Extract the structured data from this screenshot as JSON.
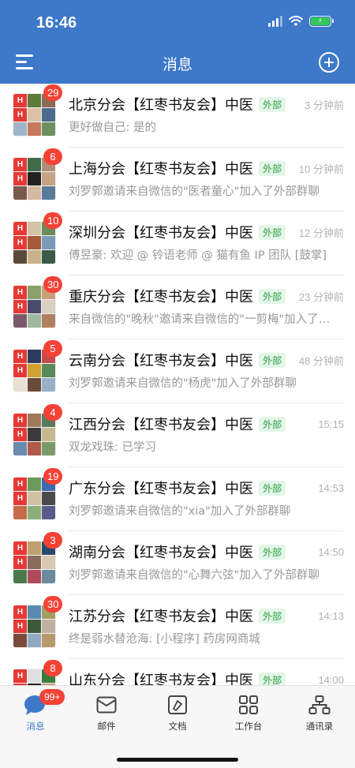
{
  "status": {
    "time": "16:46"
  },
  "header": {
    "title": "消息"
  },
  "colors": {
    "brand": "#3d78c9",
    "badge": "#f44336",
    "tag_green": "#2e9e45"
  },
  "icons": {
    "menu": "menu-icon",
    "add": "add-circle-icon"
  },
  "conversations": [
    {
      "name": "北京分会【红枣书友会】中医",
      "tag": "外部",
      "time": "3 分钟前",
      "preview": "更好做自己: 是的",
      "badge": "29"
    },
    {
      "name": "上海分会【红枣书友会】中医",
      "tag": "外部",
      "time": "10 分钟前",
      "preview": "刘罗郭邀请来自微信的\"医者童心\"加入了外部群聊",
      "badge": "6"
    },
    {
      "name": "深圳分会【红枣书友会】中医",
      "tag": "外部",
      "time": "12 分钟前",
      "preview": "傅昱豪: 欢迎 @ 铃语老师 @ 猫有鱼 IP 团队 [鼓掌]",
      "badge": "10"
    },
    {
      "name": "重庆分会【红枣书友会】中医",
      "tag": "外部",
      "time": "23 分钟前",
      "preview": "来自微信的\"晚秋\"邀请来自微信的\"一剪梅\"加入了外部群聊",
      "badge": "30"
    },
    {
      "name": "云南分会【红枣书友会】中医",
      "tag": "外部",
      "time": "48 分钟前",
      "preview": "刘罗郭邀请来自微信的\"杨虎\"加入了外部群聊",
      "badge": "5"
    },
    {
      "name": "江西分会【红枣书友会】中医",
      "tag": "外部",
      "time": "15:15",
      "preview": "双龙戏珠: 已学习",
      "badge": "4"
    },
    {
      "name": "广东分会【红枣书友会】中医",
      "tag": "外部",
      "time": "14:53",
      "preview": "刘罗郭邀请来自微信的\"xia\"加入了外部群聊",
      "badge": "19"
    },
    {
      "name": "湖南分会【红枣书友会】中医",
      "tag": "外部",
      "time": "14:50",
      "preview": "刘罗郭邀请来自微信的\"心舞六弦\"加入了外部群聊",
      "badge": "3"
    },
    {
      "name": "江苏分会【红枣书友会】中医",
      "tag": "外部",
      "time": "14:13",
      "preview": "终是弱水替沧海: [小程序] 药房网商城",
      "badge": "30"
    },
    {
      "name": "山东分会【红枣书友会】中医",
      "tag": "外部",
      "time": "14:00",
      "preview": "",
      "badge": "8"
    }
  ],
  "tabs": [
    {
      "label": "消息",
      "badge": "99+",
      "icon": "chat-bubble-icon"
    },
    {
      "label": "邮件",
      "icon": "mail-icon"
    },
    {
      "label": "文档",
      "icon": "document-icon"
    },
    {
      "label": "工作台",
      "icon": "workbench-grid-icon"
    },
    {
      "label": "通讯录",
      "icon": "contacts-org-icon"
    }
  ]
}
